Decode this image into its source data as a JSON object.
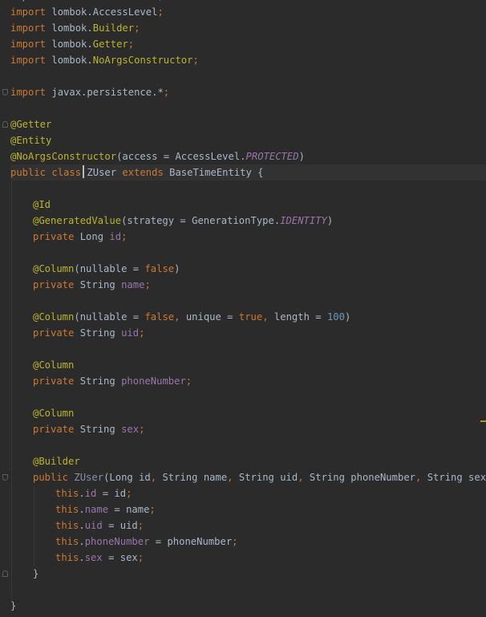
{
  "editor": {
    "language": "java",
    "colors": {
      "background": "#2b2b2b",
      "keyword": "#cc7832",
      "annotation": "#bbb529",
      "field": "#9876aa",
      "number": "#6897bb",
      "text": "#a9b7c6"
    },
    "lines": [
      [
        {
          "t": "import lombok.AccessLevel",
          "c": "cls"
        },
        {
          "t": ";",
          "c": "pnc"
        }
      ],
      [
        {
          "t": "import ",
          "c": "kw"
        },
        {
          "t": "lombok.AccessLevel",
          "c": "cls"
        },
        {
          "t": ";",
          "c": "pnc"
        }
      ],
      [
        {
          "t": "import ",
          "c": "kw"
        },
        {
          "t": "lombok.",
          "c": "cls"
        },
        {
          "t": "Builder",
          "c": "ann"
        },
        {
          "t": ";",
          "c": "pnc"
        }
      ],
      [
        {
          "t": "import ",
          "c": "kw"
        },
        {
          "t": "lombok.",
          "c": "cls"
        },
        {
          "t": "Getter",
          "c": "ann"
        },
        {
          "t": ";",
          "c": "pnc"
        }
      ],
      [
        {
          "t": "import ",
          "c": "kw"
        },
        {
          "t": "lombok.",
          "c": "cls"
        },
        {
          "t": "NoArgsConstructor",
          "c": "ann"
        },
        {
          "t": ";",
          "c": "pnc"
        }
      ],
      [],
      [
        {
          "t": "import ",
          "c": "kw"
        },
        {
          "t": "javax.persistence.*",
          "c": "cls"
        },
        {
          "t": ";",
          "c": "pnc"
        }
      ],
      [],
      [
        {
          "t": "@Getter",
          "c": "ann"
        }
      ],
      [
        {
          "t": "@Entity",
          "c": "ann"
        }
      ],
      [
        {
          "t": "@NoArgsConstructor",
          "c": "ann"
        },
        {
          "t": "(access = AccessLevel.",
          "c": "cls"
        },
        {
          "t": "PROTECTED",
          "c": "cst"
        },
        {
          "t": ")",
          "c": "cls"
        }
      ],
      [
        {
          "t": "public class ",
          "c": "kw"
        },
        {
          "t": "ZUser ",
          "c": "cls"
        },
        {
          "t": "extends ",
          "c": "kw"
        },
        {
          "t": "BaseTimeEntity {",
          "c": "cls"
        }
      ],
      [],
      [
        {
          "t": "@Id",
          "c": "ann"
        }
      ],
      [
        {
          "t": "@GeneratedValue",
          "c": "ann"
        },
        {
          "t": "(strategy = GenerationType.",
          "c": "cls"
        },
        {
          "t": "IDENTITY",
          "c": "cst"
        },
        {
          "t": ")",
          "c": "cls"
        }
      ],
      [
        {
          "t": "private ",
          "c": "kw"
        },
        {
          "t": "Long ",
          "c": "cls"
        },
        {
          "t": "id",
          "c": "fld"
        },
        {
          "t": ";",
          "c": "pnc"
        }
      ],
      [],
      [
        {
          "t": "@Column",
          "c": "ann"
        },
        {
          "t": "(nullable = ",
          "c": "cls"
        },
        {
          "t": "false",
          "c": "kw"
        },
        {
          "t": ")",
          "c": "cls"
        }
      ],
      [
        {
          "t": "private ",
          "c": "kw"
        },
        {
          "t": "String ",
          "c": "cls"
        },
        {
          "t": "name",
          "c": "fld"
        },
        {
          "t": ";",
          "c": "pnc"
        }
      ],
      [],
      [
        {
          "t": "@Column",
          "c": "ann"
        },
        {
          "t": "(nullable = ",
          "c": "cls"
        },
        {
          "t": "false",
          "c": "kw"
        },
        {
          "t": ", ",
          "c": "pnc"
        },
        {
          "t": "unique = ",
          "c": "cls"
        },
        {
          "t": "true",
          "c": "kw"
        },
        {
          "t": ", ",
          "c": "pnc"
        },
        {
          "t": "length = ",
          "c": "cls"
        },
        {
          "t": "100",
          "c": "num"
        },
        {
          "t": ")",
          "c": "cls"
        }
      ],
      [
        {
          "t": "private ",
          "c": "kw"
        },
        {
          "t": "String ",
          "c": "cls"
        },
        {
          "t": "uid",
          "c": "fld"
        },
        {
          "t": ";",
          "c": "pnc"
        }
      ],
      [],
      [
        {
          "t": "@Column",
          "c": "ann"
        }
      ],
      [
        {
          "t": "private ",
          "c": "kw"
        },
        {
          "t": "String ",
          "c": "cls"
        },
        {
          "t": "phoneNumber",
          "c": "fld"
        },
        {
          "t": ";",
          "c": "pnc"
        }
      ],
      [],
      [
        {
          "t": "@Column",
          "c": "ann"
        }
      ],
      [
        {
          "t": "private ",
          "c": "kw"
        },
        {
          "t": "String ",
          "c": "cls"
        },
        {
          "t": "sex",
          "c": "fld"
        },
        {
          "t": ";",
          "c": "pnc"
        }
      ],
      [],
      [
        {
          "t": "@Builder",
          "c": "ann"
        }
      ],
      [
        {
          "t": "public ",
          "c": "kw"
        },
        {
          "t": "ZUser",
          "c": "ctor"
        },
        {
          "t": "(Long id",
          "c": "cls"
        },
        {
          "t": ", ",
          "c": "pnc"
        },
        {
          "t": "String name",
          "c": "cls"
        },
        {
          "t": ", ",
          "c": "pnc"
        },
        {
          "t": "String uid",
          "c": "cls"
        },
        {
          "t": ", ",
          "c": "pnc"
        },
        {
          "t": "String phoneNumber",
          "c": "cls"
        },
        {
          "t": ", ",
          "c": "pnc"
        },
        {
          "t": "String sex){",
          "c": "cls"
        }
      ],
      [
        {
          "t": "this",
          "c": "kw"
        },
        {
          "t": ".",
          "c": "cls"
        },
        {
          "t": "id ",
          "c": "fld"
        },
        {
          "t": "= id",
          "c": "cls"
        },
        {
          "t": ";",
          "c": "pnc"
        }
      ],
      [
        {
          "t": "this",
          "c": "kw"
        },
        {
          "t": ".",
          "c": "cls"
        },
        {
          "t": "name ",
          "c": "fld"
        },
        {
          "t": "= name",
          "c": "cls"
        },
        {
          "t": ";",
          "c": "pnc"
        }
      ],
      [
        {
          "t": "this",
          "c": "kw"
        },
        {
          "t": ".",
          "c": "cls"
        },
        {
          "t": "uid ",
          "c": "fld"
        },
        {
          "t": "= uid",
          "c": "cls"
        },
        {
          "t": ";",
          "c": "pnc"
        }
      ],
      [
        {
          "t": "this",
          "c": "kw"
        },
        {
          "t": ".",
          "c": "cls"
        },
        {
          "t": "phoneNumber ",
          "c": "fld"
        },
        {
          "t": "= phoneNumber",
          "c": "cls"
        },
        {
          "t": ";",
          "c": "pnc"
        }
      ],
      [
        {
          "t": "this",
          "c": "kw"
        },
        {
          "t": ".",
          "c": "cls"
        },
        {
          "t": "sex ",
          "c": "fld"
        },
        {
          "t": "= sex",
          "c": "cls"
        },
        {
          "t": ";",
          "c": "pnc"
        }
      ],
      [
        {
          "t": "}",
          "c": "cls"
        }
      ],
      [],
      [
        {
          "t": "}",
          "c": "cls"
        }
      ]
    ],
    "indent": [
      0,
      0,
      0,
      0,
      0,
      0,
      0,
      0,
      0,
      0,
      0,
      0,
      0,
      1,
      1,
      1,
      0,
      1,
      1,
      0,
      1,
      1,
      0,
      1,
      1,
      0,
      1,
      1,
      0,
      1,
      1,
      2,
      2,
      2,
      2,
      2,
      1,
      0,
      0
    ],
    "current_line": 11
  }
}
